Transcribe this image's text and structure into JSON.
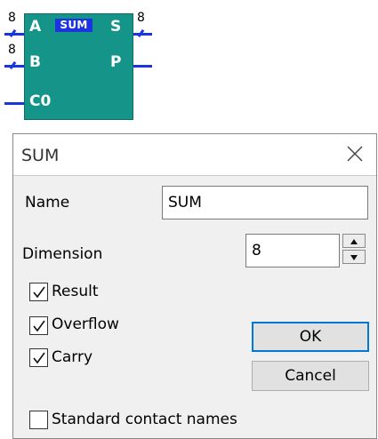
{
  "symbol": {
    "title": "SUM",
    "pins_left": [
      "A",
      "B",
      "C0"
    ],
    "pins_right": [
      "S",
      "P"
    ],
    "bus_widths": {
      "a": "8",
      "b": "8",
      "s": "8"
    },
    "wire_color": "#1c33e0",
    "body_color": "#15948a"
  },
  "dialog": {
    "title": "SUM",
    "name_label": "Name",
    "name_value": "SUM",
    "dimension_label": "Dimension",
    "dimension_value": "8",
    "checkboxes": [
      {
        "label": "Result",
        "checked": true
      },
      {
        "label": "Overflow",
        "checked": true
      },
      {
        "label": "Carry",
        "checked": true
      },
      {
        "label": "Standard contact names",
        "checked": false
      }
    ],
    "ok_label": "OK",
    "cancel_label": "Cancel",
    "accent_color": "#0078d7"
  }
}
